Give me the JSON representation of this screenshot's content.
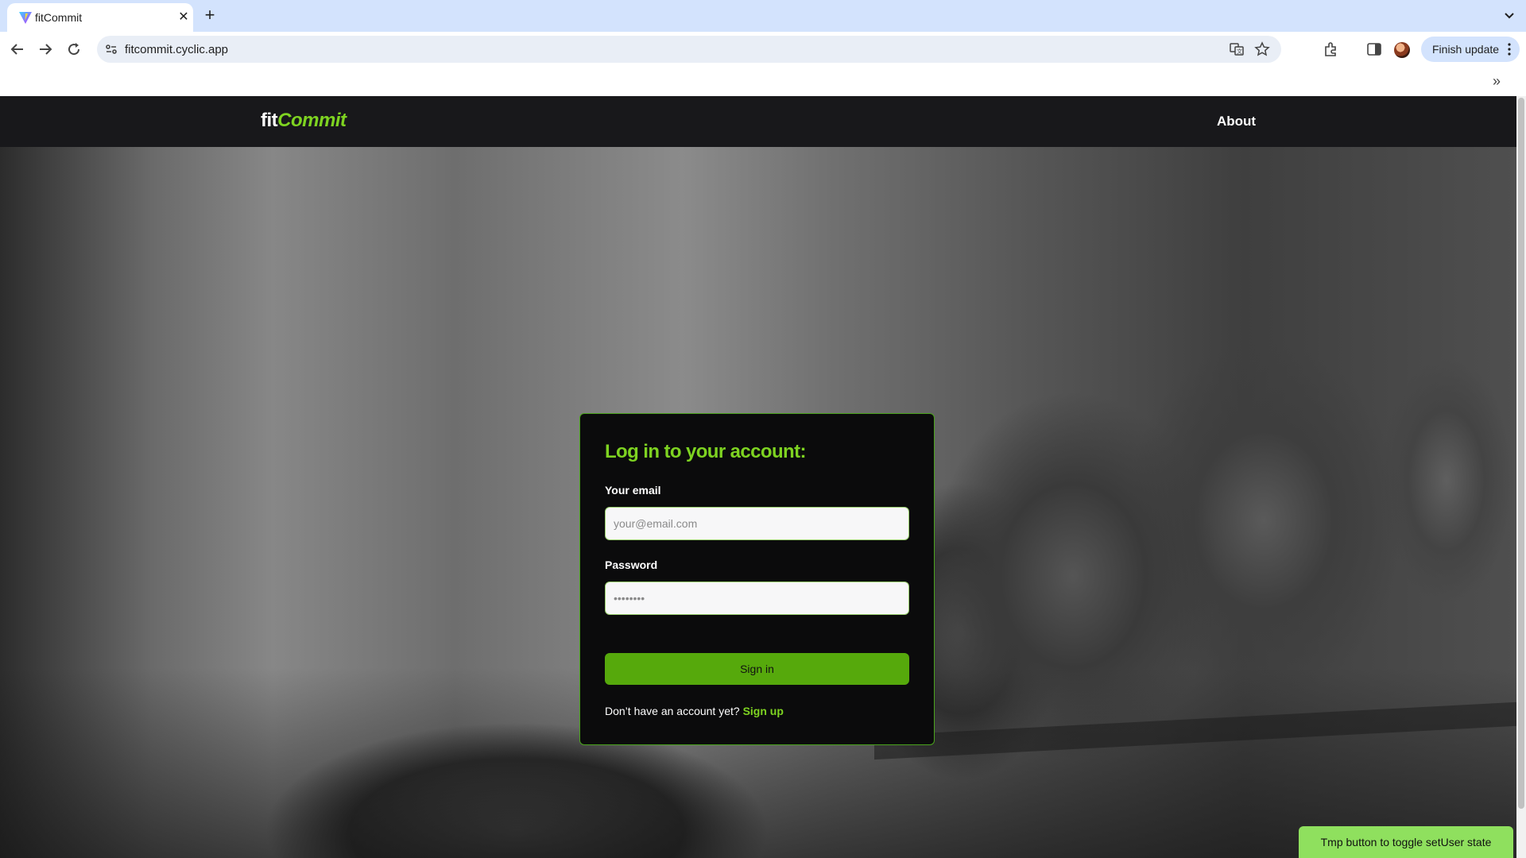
{
  "browser": {
    "tab_title": "fitCommit",
    "url": "fitcommit.cyclic.app",
    "finish_update_label": "Finish update",
    "icons": [
      "vite-favicon",
      "close-icon",
      "plus-icon",
      "chevron-down-icon",
      "back-arrow-icon",
      "forward-arrow-icon",
      "reload-icon",
      "site-info-icon",
      "translate-icon",
      "star-icon",
      "extensions-icon",
      "side-panel-icon",
      "avatar",
      "kebab-menu-icon",
      "double-chevron-icon"
    ]
  },
  "navbar": {
    "logo_fit": "fit",
    "logo_commit": "Commit",
    "about_label": "About"
  },
  "login": {
    "title": "Log in to your account:",
    "email_label": "Your email",
    "email_placeholder": "your@email.com",
    "email_value": "",
    "password_label": "Password",
    "password_placeholder": "••••••••",
    "password_value": "",
    "signin_label": "Sign in",
    "no_account_text": "Don’t have an account yet?",
    "signup_label": "Sign up"
  },
  "tmp_button_label": "Tmp button to toggle setUser state",
  "colors": {
    "brand_green": "#7ed321",
    "button_green": "#56a90c",
    "navbar_bg": "#18181b",
    "card_bg": "#0b0b0c",
    "tmp_button_bg": "#8fe05e"
  }
}
